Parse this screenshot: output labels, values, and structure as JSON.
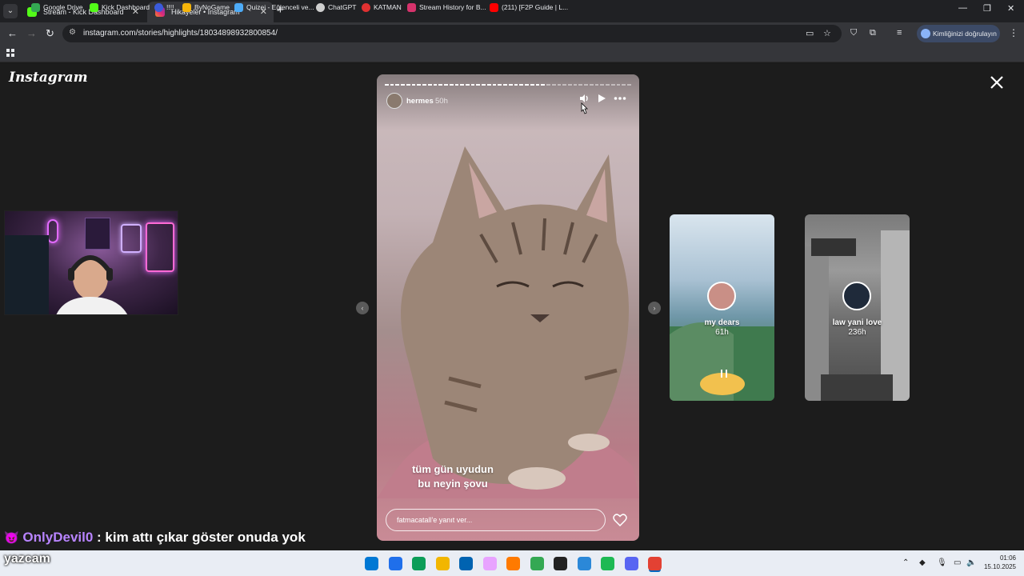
{
  "browser": {
    "tabs": [
      {
        "title": "Stream - Kick Dashboard",
        "favicon_color": "#53fc18",
        "active": false
      },
      {
        "title": "Hikayeler • Instagram",
        "favicon_color": "#e1306c",
        "active": true
      }
    ],
    "url": "instagram.com/stories/highlights/18034898932800854/",
    "profile_label": "Kimliğinizi doğrulayın",
    "bookmarks": [
      {
        "label": "Google Drive",
        "color": "#34a853"
      },
      {
        "label": "Kick Dashboard",
        "color": "#53fc18"
      },
      {
        "label": "!!!!",
        "color": "#3b5bdb"
      },
      {
        "label": "ByNoGame",
        "color": "#f5b50a"
      },
      {
        "label": "Quizei - Eğlenceli ve...",
        "color": "#4dabf7"
      },
      {
        "label": "ChatGPT",
        "color": "#cfcfcf"
      },
      {
        "label": "KATMAN",
        "color": "#e03131"
      },
      {
        "label": "Stream History for B...",
        "color": "#d6336c"
      },
      {
        "label": "(211) [F2P Guide | L...",
        "color": "#ff0000"
      }
    ]
  },
  "instagram": {
    "logo": "Instagram",
    "story": {
      "username": "hermes",
      "time": "50h",
      "caption_line1": "tüm gün uyudun",
      "caption_line2": "bu neyin şovu",
      "reply_placeholder": "fatmacatall'e yanıt ver...",
      "progress_segments_done": 30,
      "progress_segments_total": 46
    },
    "next_highlights": [
      {
        "title": "my dears",
        "time": "61h",
        "avatar_color": "#c98f86"
      },
      {
        "title": "law yani love",
        "time": "236h",
        "avatar_color": "#1f2a3a"
      }
    ]
  },
  "overlay": {
    "chat_user": "OnlyDevil0",
    "chat_message": ": kim attı çıkar göster onuda yok",
    "watermark": "yazcam"
  },
  "taskbar": {
    "time": "01:06",
    "date": "15.10.2025",
    "apps": [
      "#0078d4",
      "#1f6feb",
      "#0c9d58",
      "#f2b600",
      "#0063b1",
      "#e8a3ff",
      "#ff7a00",
      "#34a853",
      "#222222",
      "#2b88d8",
      "#1db954",
      "#5865f2",
      "#e34133"
    ]
  }
}
